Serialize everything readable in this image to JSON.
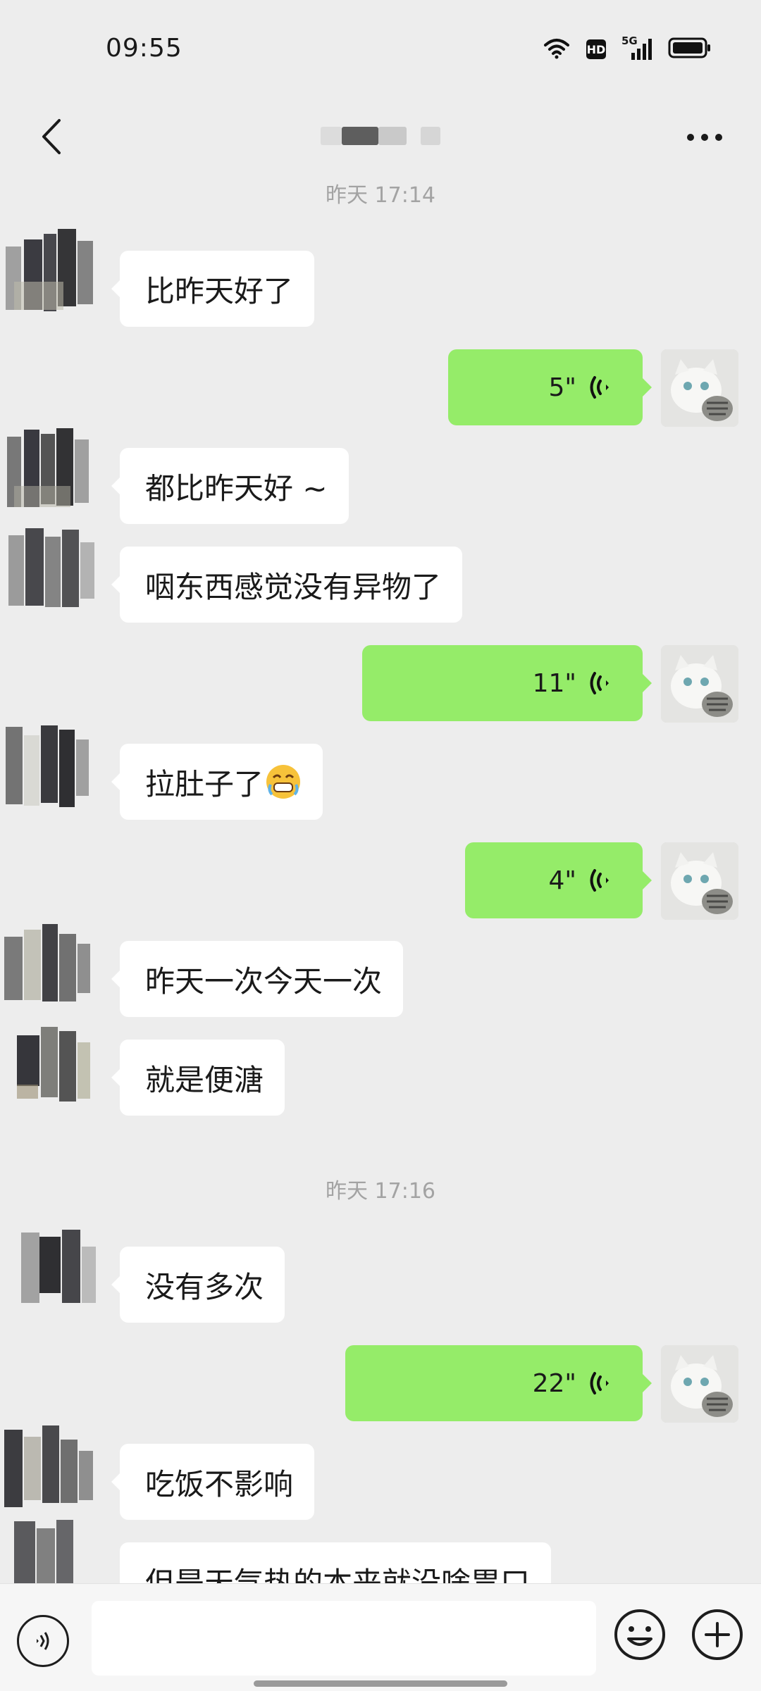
{
  "status_bar": {
    "time": "09:55",
    "hd_label": "HD",
    "network_label": "5G",
    "icons": [
      "wifi-icon",
      "hd-icon",
      "signal-5g-icon",
      "battery-icon"
    ]
  },
  "header": {
    "back_icon": "chevron-left-icon",
    "title": "",
    "more_icon": "more-dots-icon"
  },
  "chat": {
    "timestamps": [
      "昨天 17:14",
      "昨天 17:16"
    ],
    "messages": [
      {
        "side": "left",
        "text": "比昨天好了"
      },
      {
        "side": "right",
        "type": "voice",
        "duration": "5\""
      },
      {
        "side": "left",
        "text": "都比昨天好 ~"
      },
      {
        "side": "left",
        "text": "咽东西感觉没有异物了"
      },
      {
        "side": "right",
        "type": "voice",
        "duration": "11\""
      },
      {
        "side": "left",
        "text": "拉肚子了",
        "emoji": "grimace-emoji"
      },
      {
        "side": "right",
        "type": "voice",
        "duration": "4\""
      },
      {
        "side": "left",
        "text": "昨天一次今天一次"
      },
      {
        "side": "left",
        "text": "就是便溏"
      },
      {
        "side": "left",
        "text": "没有多次"
      },
      {
        "side": "right",
        "type": "voice",
        "duration": "22\""
      },
      {
        "side": "left",
        "text": "吃饭不影响"
      },
      {
        "side": "left",
        "text": "但是天气热的本来就没啥胃口"
      }
    ]
  },
  "input_bar": {
    "voice_icon": "voice-input-icon",
    "input_value": "",
    "emoji_icon": "smiley-icon",
    "plus_icon": "plus-icon"
  },
  "colors": {
    "background": "#ededed",
    "bubble_self": "#95ec69",
    "bubble_other": "#ffffff",
    "timestamp": "#a3a3a3"
  }
}
